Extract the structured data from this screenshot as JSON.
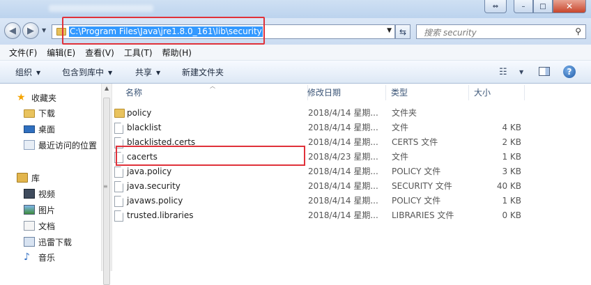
{
  "window": {
    "close_glyph": "✕",
    "max_glyph": "□",
    "min_glyph": "–",
    "resize_glyph": "⇔"
  },
  "address": {
    "path": "C:\\Program Files\\Java\\jre1.8.0_161\\lib\\security",
    "search_placeholder": "搜索 security"
  },
  "menu": [
    "文件(F)",
    "编辑(E)",
    "查看(V)",
    "工具(T)",
    "帮助(H)"
  ],
  "toolbar": {
    "organize": "组织",
    "include_in_library": "包含到库中",
    "share": "共享",
    "new_folder": "新建文件夹",
    "help": "?"
  },
  "sidebar": {
    "favorites": "收藏夹",
    "downloads": "下载",
    "desktop": "桌面",
    "recent": "最近访问的位置",
    "libraries": "库",
    "videos": "视频",
    "pictures": "图片",
    "documents": "文档",
    "thunder": "迅雷下载",
    "music": "音乐"
  },
  "columns": {
    "name": "名称",
    "date": "修改日期",
    "type": "类型",
    "size": "大小"
  },
  "files": [
    {
      "icon": "folder-icon",
      "name": "policy",
      "date": "2018/4/14 星期...",
      "type": "文件夹",
      "size": ""
    },
    {
      "icon": "file-icon",
      "name": "blacklist",
      "date": "2018/4/14 星期...",
      "type": "文件",
      "size": "4 KB"
    },
    {
      "icon": "file-icon",
      "name": "blacklisted.certs",
      "date": "2018/4/14 星期...",
      "type": "CERTS 文件",
      "size": "2 KB"
    },
    {
      "icon": "file-icon",
      "name": "cacerts",
      "date": "2018/4/23 星期...",
      "type": "文件",
      "size": "1 KB"
    },
    {
      "icon": "file-icon",
      "name": "java.policy",
      "date": "2018/4/14 星期...",
      "type": "POLICY 文件",
      "size": "3 KB"
    },
    {
      "icon": "file-icon",
      "name": "java.security",
      "date": "2018/4/14 星期...",
      "type": "SECURITY 文件",
      "size": "40 KB"
    },
    {
      "icon": "file-icon",
      "name": "javaws.policy",
      "date": "2018/4/14 星期...",
      "type": "POLICY 文件",
      "size": "1 KB"
    },
    {
      "icon": "file-icon",
      "name": "trusted.libraries",
      "date": "2018/4/14 星期...",
      "type": "LIBRARIES 文件",
      "size": "0 KB"
    }
  ],
  "annotation_color": "#e0313a"
}
